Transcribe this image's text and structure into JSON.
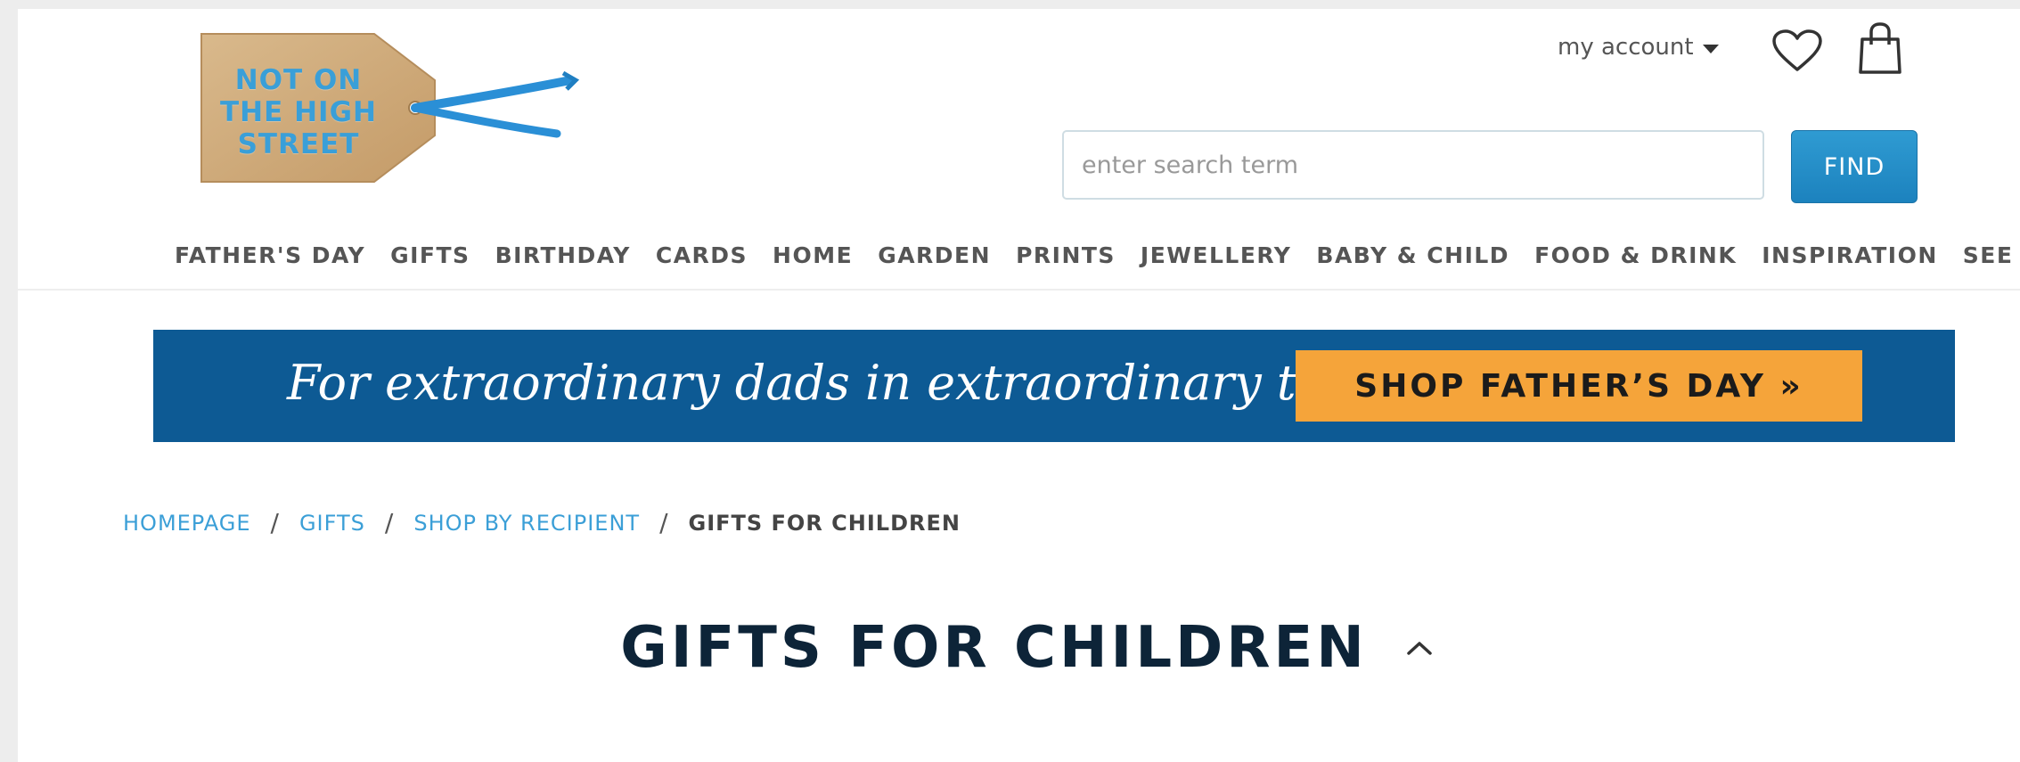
{
  "logo": {
    "lines": [
      "NOT ON",
      "THE HIGH",
      "STREET"
    ]
  },
  "header": {
    "account_label": "my account",
    "icons": {
      "wishlist": "heart-icon",
      "basket": "shopping-bag-icon",
      "account_menu": "caret-down-icon"
    }
  },
  "search": {
    "placeholder": "enter search term",
    "value": "",
    "button_label": "FIND"
  },
  "nav": {
    "items": [
      "FATHER'S DAY",
      "GIFTS",
      "BIRTHDAY",
      "CARDS",
      "HOME",
      "GARDEN",
      "PRINTS",
      "JEWELLERY",
      "BABY & CHILD",
      "FOOD & DRINK",
      "INSPIRATION",
      "SEE MORE"
    ]
  },
  "banner": {
    "headline": "For extraordinary dads in extraordinary times",
    "cta_label": "SHOP FATHER’S DAY »"
  },
  "breadcrumb": {
    "links": [
      "HOMEPAGE",
      "GIFTS",
      "SHOP BY RECIPIENT"
    ],
    "separator": "/",
    "current": "GIFTS FOR CHILDREN"
  },
  "page": {
    "title": "GIFTS FOR CHILDREN"
  },
  "colors": {
    "accent_blue": "#3b9fd7",
    "find_button": "#1c82be",
    "banner_bg": "#0d5a94",
    "banner_cta": "#f5a43a",
    "title_text": "#0d2438"
  }
}
